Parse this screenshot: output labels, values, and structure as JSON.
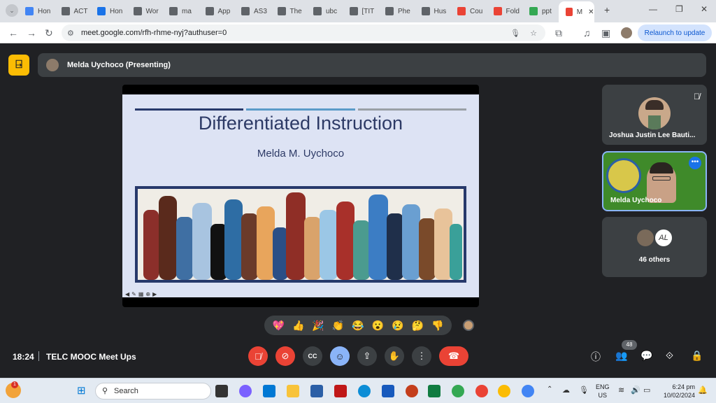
{
  "browser": {
    "tabs": [
      {
        "label": "Hon",
        "color": "#4285f4"
      },
      {
        "label": "ACT",
        "color": "#5f6368"
      },
      {
        "label": "Hon",
        "color": "#1a73e8"
      },
      {
        "label": "Wor",
        "color": "#5f6368"
      },
      {
        "label": "ma",
        "color": "#5f6368"
      },
      {
        "label": "App",
        "color": "#5f6368"
      },
      {
        "label": "AS3",
        "color": "#5f6368"
      },
      {
        "label": "The",
        "color": "#5f6368"
      },
      {
        "label": "ubc",
        "color": "#5f6368"
      },
      {
        "label": "[TIT",
        "color": "#5f6368"
      },
      {
        "label": "Phe",
        "color": "#5f6368"
      },
      {
        "label": "Hus",
        "color": "#5f6368"
      },
      {
        "label": "Cou",
        "color": "#ea4335"
      },
      {
        "label": "Fold",
        "color": "#ea4335"
      },
      {
        "label": "ppt",
        "color": "#34a853"
      },
      {
        "label": "M",
        "color": "#ea4335"
      }
    ],
    "url": "meet.google.com/rfh-rhme-nyj?authuser=0",
    "relaunch_label": "Relaunch to update"
  },
  "meet": {
    "presenting_label": "Melda Uychoco (Presenting)",
    "slide": {
      "title": "Differentiated Instruction",
      "subtitle": "Melda M. Uychoco"
    },
    "participants": [
      {
        "name": "Joshua Justin Lee Bauti..."
      },
      {
        "name": "Melda Uychoco"
      }
    ],
    "others_label": "46 others",
    "others_initials": "AL",
    "people_count": "48",
    "time": "18:24",
    "meeting_name": "TELC MOOC Meet Ups",
    "reactions": [
      "💖",
      "👍",
      "🎉",
      "👏",
      "😂",
      "😮",
      "😢",
      "🤔",
      "👎"
    ]
  },
  "taskbar": {
    "search_placeholder": "Search",
    "notification_badge": "1",
    "lang_line1": "ENG",
    "lang_line2": "US",
    "clock_time": "6:24 pm",
    "clock_date": "10/02/2024"
  },
  "colors": {
    "end_call": "#ea4335",
    "mute": "#ea4335",
    "active": "#8ab4f8"
  }
}
